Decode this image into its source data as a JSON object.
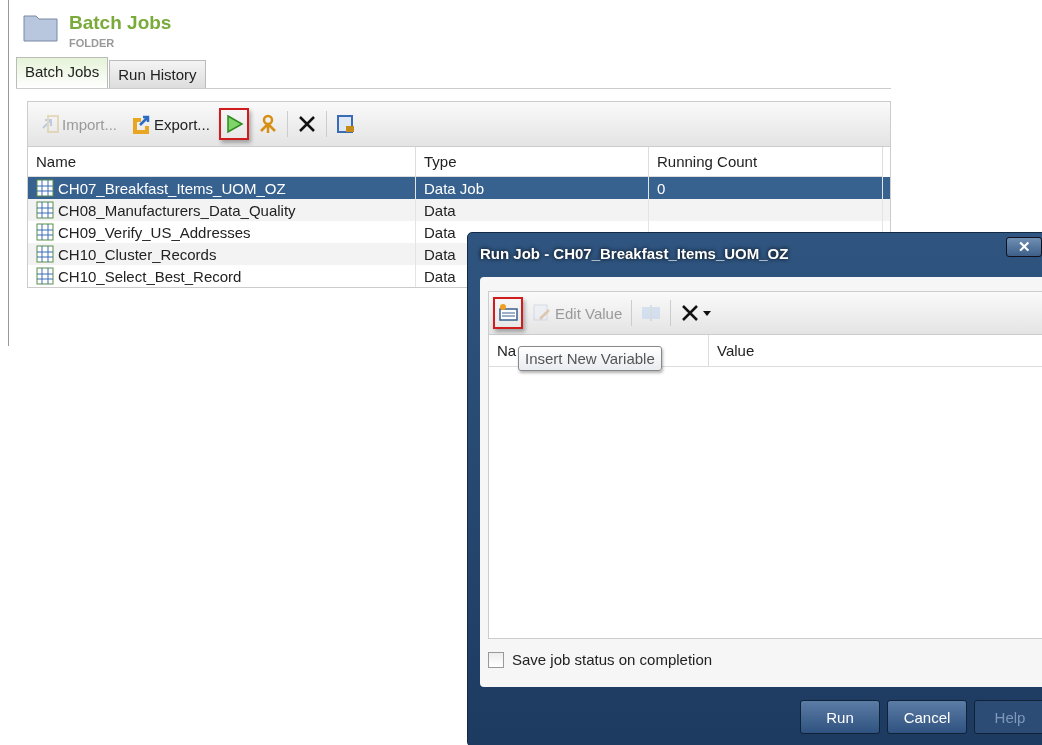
{
  "header": {
    "title": "Batch Jobs",
    "subtitle": "FOLDER"
  },
  "tabs": [
    {
      "label": "Batch Jobs",
      "selected": true
    },
    {
      "label": "Run History",
      "selected": false
    }
  ],
  "toolbar": [
    {
      "kind": "import",
      "label": "Import...",
      "disabled": true,
      "highlighted": false
    },
    {
      "kind": "export",
      "label": "Export...",
      "disabled": false,
      "highlighted": false
    },
    {
      "kind": "run",
      "disabled": false,
      "highlighted": true
    },
    {
      "kind": "keys",
      "disabled": false,
      "highlighted": false
    },
    {
      "kind": "separator"
    },
    {
      "kind": "delete",
      "disabled": false,
      "highlighted": false
    },
    {
      "kind": "separator"
    },
    {
      "kind": "view",
      "disabled": false,
      "highlighted": false
    }
  ],
  "table": {
    "columns": [
      "Name",
      "Type",
      "Running Count"
    ],
    "rows": [
      {
        "cells": [
          "CH07_Breakfast_Items_UOM_OZ",
          "Data Job",
          "0"
        ],
        "selected": true
      },
      {
        "cells": [
          "CH08_Manufacturers_Data_Quality",
          "Data"
        ],
        "selected": false
      },
      {
        "cells": [
          "CH09_Verify_US_Addresses",
          "Data"
        ],
        "selected": false
      },
      {
        "cells": [
          "CH10_Cluster_Records",
          "Data"
        ],
        "selected": false
      },
      {
        "cells": [
          "CH10_Select_Best_Record",
          "Data"
        ],
        "selected": false
      }
    ]
  },
  "dialog": {
    "title": "Run Job - CH07_Breakfast_Items_UOM_OZ",
    "toolbar": [
      {
        "kind": "insert",
        "disabled": false,
        "highlighted": true
      },
      {
        "kind": "edit",
        "label": "Edit Value",
        "disabled": true,
        "highlighted": false
      },
      {
        "kind": "separator"
      },
      {
        "kind": "split",
        "disabled": true,
        "highlighted": false
      },
      {
        "kind": "separator"
      },
      {
        "kind": "delete-menu",
        "disabled": false,
        "highlighted": false
      }
    ],
    "close": "✕",
    "tooltip": "Insert New Variable",
    "columns": [
      "Na",
      "Value"
    ],
    "checkbox": {
      "label": "Save job status on completion",
      "checked": false
    },
    "buttons": [
      {
        "label": "Run",
        "disabled": false
      },
      {
        "label": "Cancel",
        "disabled": false
      },
      {
        "label": "Help",
        "disabled": true
      }
    ]
  }
}
